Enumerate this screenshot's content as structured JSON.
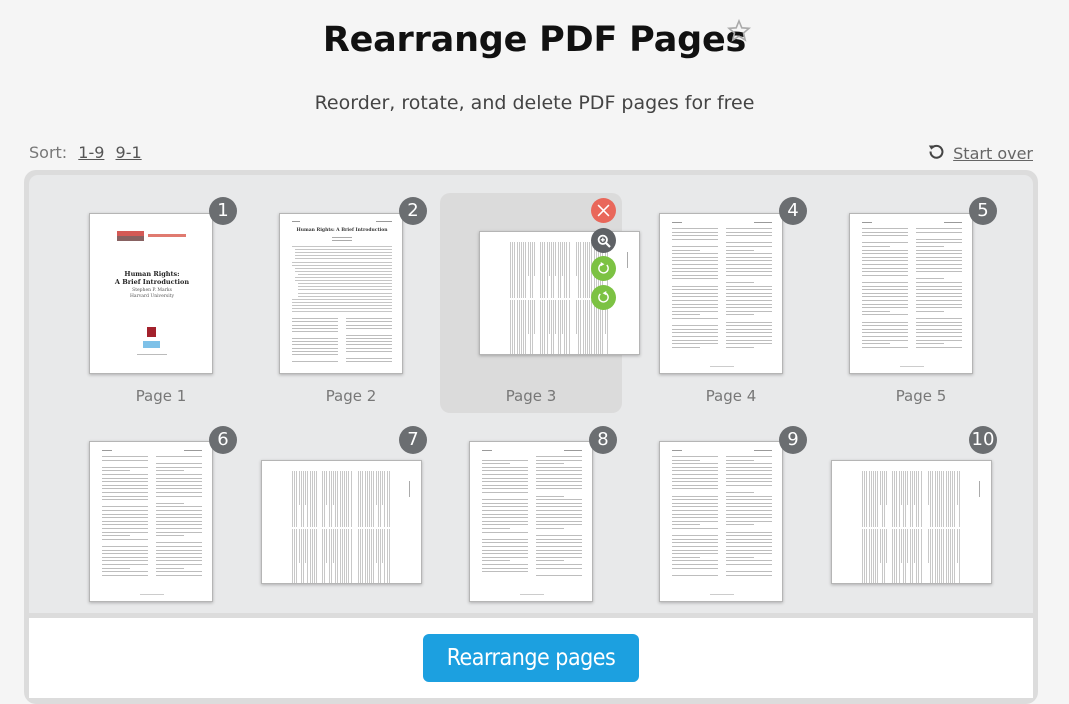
{
  "header": {
    "title": "Rearrange PDF Pages",
    "subtitle": "Reorder, rotate, and delete PDF pages for free",
    "favorite_icon": "star-outline-icon"
  },
  "toolbar": {
    "sort_label": "Sort:",
    "sort_options": [
      "1-9",
      "9-1"
    ],
    "start_over_label": "Start over",
    "start_over_icon": "refresh-icon"
  },
  "pages": [
    {
      "number": "1",
      "label": "Page 1",
      "orientation": "portrait",
      "kind": "cover"
    },
    {
      "number": "2",
      "label": "Page 2",
      "orientation": "portrait",
      "kind": "toc"
    },
    {
      "number": "",
      "label": "Page 3",
      "orientation": "landscape",
      "kind": "text",
      "selected": true
    },
    {
      "number": "4",
      "label": "Page 4",
      "orientation": "portrait",
      "kind": "text"
    },
    {
      "number": "5",
      "label": "Page 5",
      "orientation": "portrait",
      "kind": "text"
    },
    {
      "number": "6",
      "label": "",
      "orientation": "portrait",
      "kind": "text"
    },
    {
      "number": "7",
      "label": "",
      "orientation": "landscape",
      "kind": "text"
    },
    {
      "number": "8",
      "label": "",
      "orientation": "portrait",
      "kind": "text"
    },
    {
      "number": "9",
      "label": "",
      "orientation": "portrait",
      "kind": "text"
    },
    {
      "number": "10",
      "label": "",
      "orientation": "landscape",
      "kind": "text"
    }
  ],
  "page_actions": {
    "delete_icon": "close-icon",
    "zoom_icon": "zoom-in-icon",
    "rotate_right_icon": "rotate-clockwise-icon",
    "rotate_left_icon": "rotate-counterclockwise-icon"
  },
  "cover": {
    "title_line1": "Human Rights:",
    "title_line2": "A Brief Introduction",
    "author": "Stephen P. Marks",
    "affiliation": "Harvard University"
  },
  "toc_heading": "Human Rights: A Brief Introduction",
  "submit": {
    "label": "Rearrange pages"
  },
  "colors": {
    "primary": "#1ca0e0",
    "delete": "#e9675a",
    "rotate": "#7cc243",
    "badge": "#6b6e71"
  }
}
